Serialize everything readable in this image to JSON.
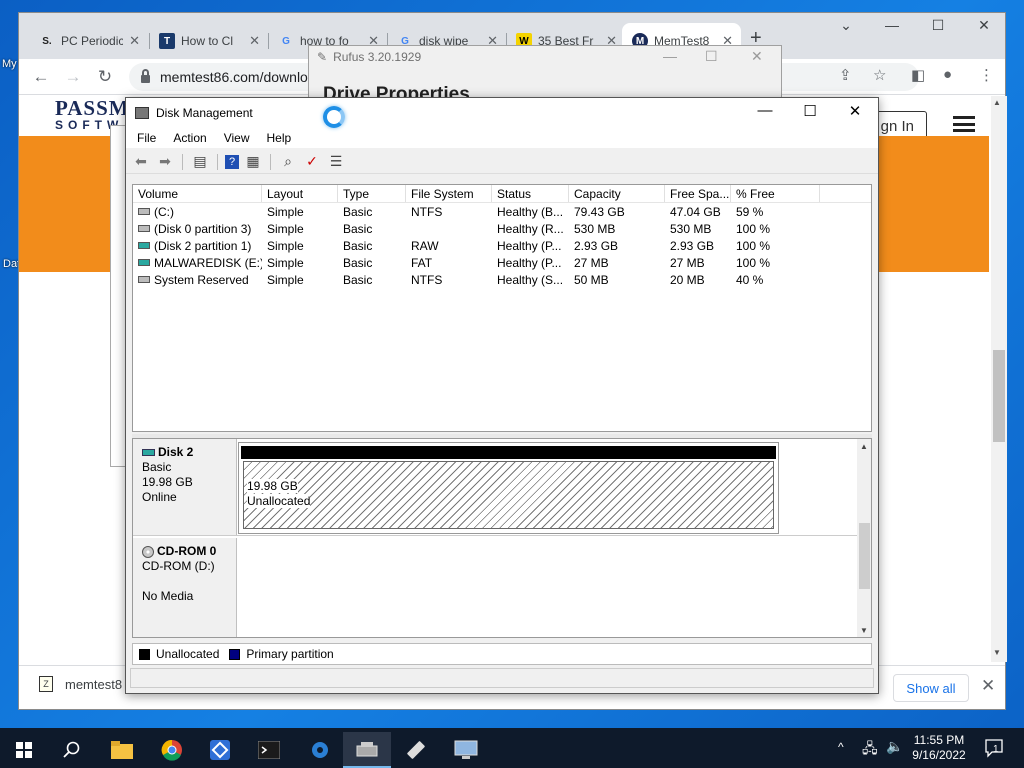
{
  "desktop": {
    "left_labels": [
      "My",
      "Dat"
    ]
  },
  "chrome": {
    "tabs": [
      {
        "label": "PC Periodic",
        "favicon": "S.",
        "fav_bg": "#ffffff",
        "fav_color": "#222222"
      },
      {
        "label": "How to Cl",
        "favicon": "T",
        "fav_bg": "#1a3a6b",
        "fav_color": "#ffffff"
      },
      {
        "label": "how to fo",
        "favicon": "G",
        "fav_bg": "#ffffff",
        "fav_color": "#4285f4"
      },
      {
        "label": "disk wipe",
        "favicon": "G",
        "fav_bg": "#ffffff",
        "fav_color": "#4285f4"
      },
      {
        "label": "35 Best Fr",
        "favicon": "W",
        "fav_bg": "#f4d300",
        "fav_color": "#000000"
      },
      {
        "label": "MemTest8",
        "favicon": "M",
        "fav_bg": "#1a2a58",
        "fav_color": "#ffffff",
        "active": true
      }
    ],
    "url": "memtest86.com/downlo",
    "page": {
      "brand_top": "PASSM",
      "brand_bottom": "SOFTW",
      "signin_label": "gn In"
    },
    "download_bar": {
      "file_label": "memtest8",
      "show_all_label": "Show all"
    }
  },
  "rufus": {
    "title": "Rufus 3.20.1929",
    "heading": "Drive Properties"
  },
  "disk_management": {
    "title": "Disk Management",
    "menu": [
      "File",
      "Action",
      "View",
      "Help"
    ],
    "columns": [
      "Volume",
      "Layout",
      "Type",
      "File System",
      "Status",
      "Capacity",
      "Free Spa...",
      "% Free"
    ],
    "volumes": [
      {
        "icon": "gray",
        "cells": [
          "(C:)",
          "Simple",
          "Basic",
          "NTFS",
          "Healthy (B...",
          "79.43 GB",
          "47.04 GB",
          "59 %"
        ]
      },
      {
        "icon": "gray",
        "cells": [
          "(Disk 0 partition 3)",
          "Simple",
          "Basic",
          "",
          "Healthy (R...",
          "530 MB",
          "530 MB",
          "100 %"
        ]
      },
      {
        "icon": "teal",
        "cells": [
          "(Disk 2 partition 1)",
          "Simple",
          "Basic",
          "RAW",
          "Healthy (P...",
          "2.93 GB",
          "2.93 GB",
          "100 %"
        ]
      },
      {
        "icon": "teal",
        "cells": [
          "MALWAREDISK (E:)",
          "Simple",
          "Basic",
          "FAT",
          "Healthy (P...",
          "27 MB",
          "27 MB",
          "100 %"
        ]
      },
      {
        "icon": "gray",
        "cells": [
          "System Reserved",
          "Simple",
          "Basic",
          "NTFS",
          "Healthy (S...",
          "50 MB",
          "20 MB",
          "40 %"
        ]
      }
    ],
    "disks": [
      {
        "name": "Disk 2",
        "lines": [
          "Basic",
          "19.98 GB",
          "Online"
        ],
        "partition": {
          "size": "19.98 GB",
          "label": "Unallocated"
        }
      },
      {
        "name": "CD-ROM 0",
        "lines": [
          "CD-ROM (D:)",
          "",
          "No Media"
        ]
      }
    ],
    "legend": [
      {
        "label": "Unallocated",
        "color": "#000000"
      },
      {
        "label": "Primary partition",
        "color": "#000080"
      }
    ]
  },
  "taskbar": {
    "time": "11:55 PM",
    "date": "9/16/2022",
    "notification_count": "1"
  }
}
